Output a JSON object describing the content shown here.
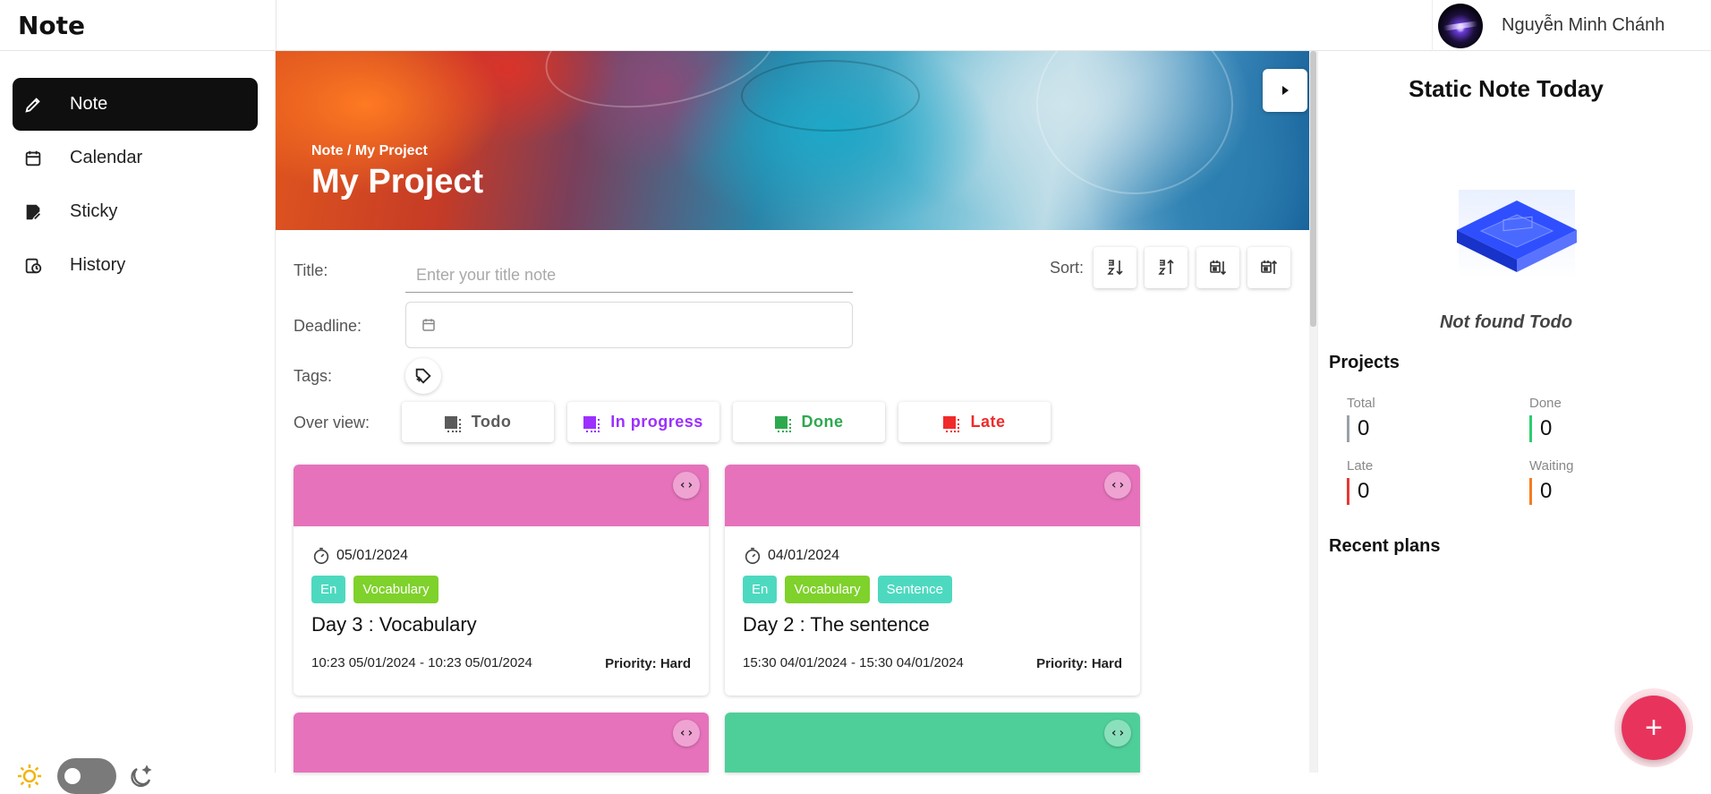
{
  "app": {
    "brand": "Note"
  },
  "user": {
    "name": "Nguyễn Minh Chánh"
  },
  "sidebar": {
    "items": [
      {
        "label": "Note",
        "icon": "pencil-icon",
        "active": true
      },
      {
        "label": "Calendar",
        "icon": "calendar-icon",
        "active": false
      },
      {
        "label": "Sticky",
        "icon": "sticky-note-icon",
        "active": false
      },
      {
        "label": "History",
        "icon": "history-icon",
        "active": false
      }
    ],
    "theme": {
      "mode": "light"
    }
  },
  "banner": {
    "breadcrumb": "Note / My Project",
    "title": "My Project"
  },
  "form": {
    "title_label": "Title:",
    "title_placeholder": "Enter your title note",
    "title_value": "",
    "deadline_label": "Deadline:",
    "tags_label": "Tags:",
    "overview_label": "Over view:",
    "sort_label": "Sort:",
    "overview": [
      {
        "label": "Todo",
        "color": "#5b5b5b"
      },
      {
        "label": "In progress",
        "color": "#9b30ff"
      },
      {
        "label": "Done",
        "color": "#2ea84f"
      },
      {
        "label": "Late",
        "color": "#f02a2a"
      }
    ],
    "sort_buttons": [
      "sort-az-icon",
      "sort-za-icon",
      "sort-date-asc-icon",
      "sort-date-desc-icon"
    ]
  },
  "cards": [
    {
      "color": "#e672bb",
      "date": "05/01/2024",
      "tags": [
        {
          "label": "En",
          "color": "#4dd9c0"
        },
        {
          "label": "Vocabulary",
          "color": "#7fd12b"
        }
      ],
      "title": "Day 3 : Vocabulary",
      "range": "10:23 05/01/2024 - 10:23 05/01/2024",
      "priority": "Priority: Hard"
    },
    {
      "color": "#e672bb",
      "date": "04/01/2024",
      "tags": [
        {
          "label": "En",
          "color": "#4dd9c0"
        },
        {
          "label": "Vocabulary",
          "color": "#7fd12b"
        },
        {
          "label": "Sentence",
          "color": "#4dd9c0"
        }
      ],
      "title": "Day 2 : The sentence",
      "range": "15:30 04/01/2024 - 15:30 04/01/2024",
      "priority": "Priority: Hard"
    },
    {
      "color": "#e672bb"
    },
    {
      "color": "#4ecf99"
    }
  ],
  "right_panel": {
    "title": "Static Note Today",
    "empty_text": "Not found Todo",
    "projects_title": "Projects",
    "stats": [
      {
        "label": "Total",
        "value": "0",
        "color": "#9aa0a8"
      },
      {
        "label": "Done",
        "value": "0",
        "color": "#2ecc71"
      },
      {
        "label": "Late",
        "value": "0",
        "color": "#e53935"
      },
      {
        "label": "Waiting",
        "value": "0",
        "color": "#f57c20"
      }
    ],
    "recent_title": "Recent plans"
  },
  "fab": {
    "label": "+"
  }
}
